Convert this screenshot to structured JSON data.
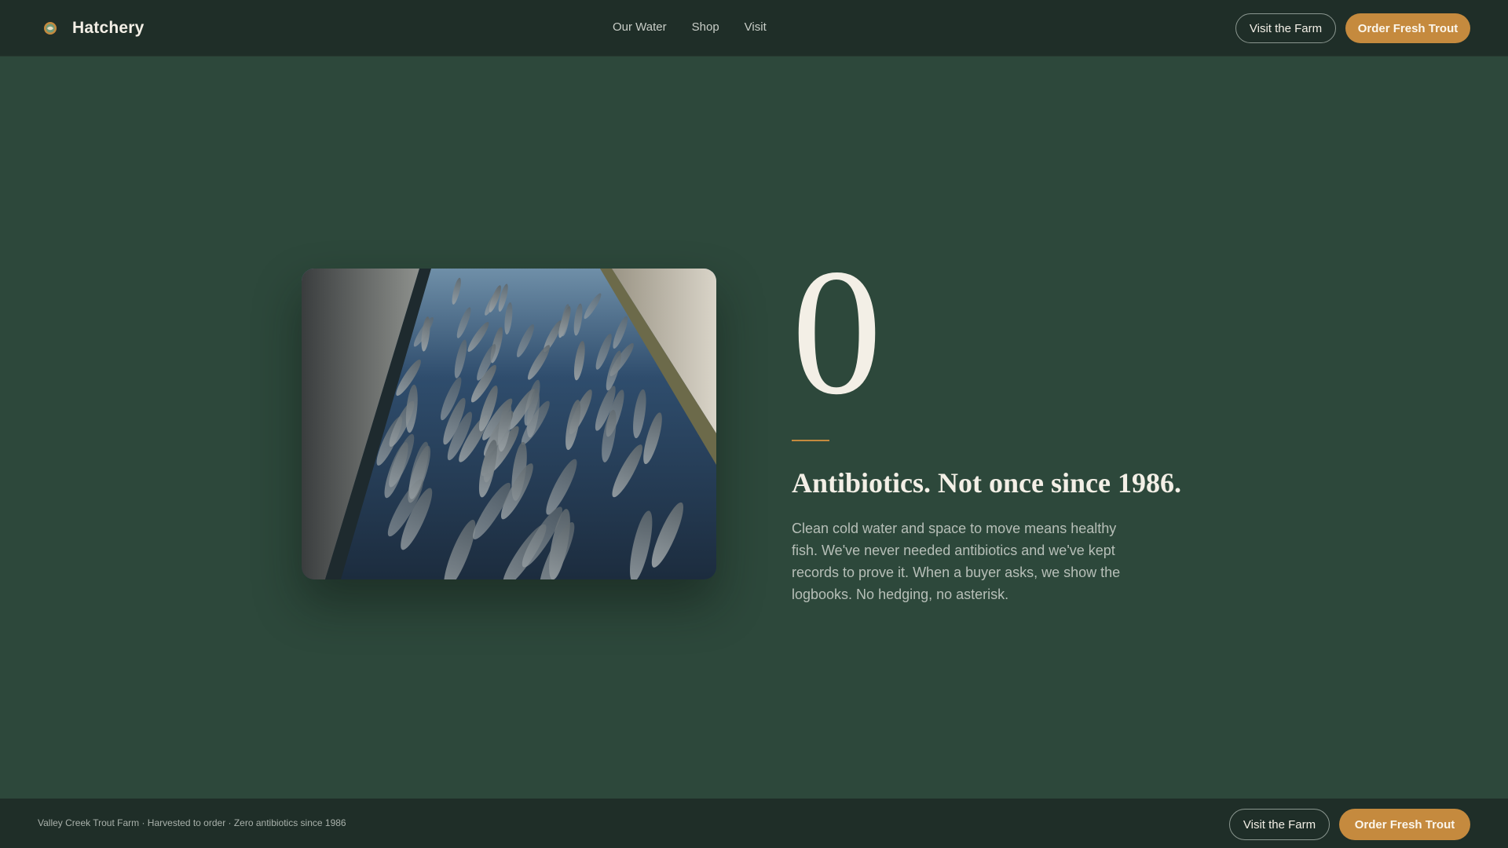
{
  "header": {
    "brand_name": "Hatchery",
    "brand_icon": "fish-badge-icon",
    "nav": [
      "Our Water",
      "Shop",
      "Visit"
    ],
    "visit_label": "Visit the Farm",
    "order_label": "Order Fresh Trout"
  },
  "hero": {
    "image": "trout-raceway-photo",
    "stat_value": "0",
    "headline": "Antibiotics. Not once since 1986.",
    "body": "Clean cold water and space to move means healthy fish. We've never needed antibiotics and we've kept records to prove it. When a buyer asks, we show the logbooks. No hedging, no asterisk."
  },
  "footer": {
    "tagline": "Valley Creek Trout Farm · Harvested to order · Zero antibiotics since 1986",
    "visit_label": "Visit the Farm",
    "order_label": "Order Fresh Trout"
  },
  "colors": {
    "background": "#2d483b",
    "header": "#1f2e28",
    "accent": "#c58a3e",
    "text": "#f3efe6"
  }
}
